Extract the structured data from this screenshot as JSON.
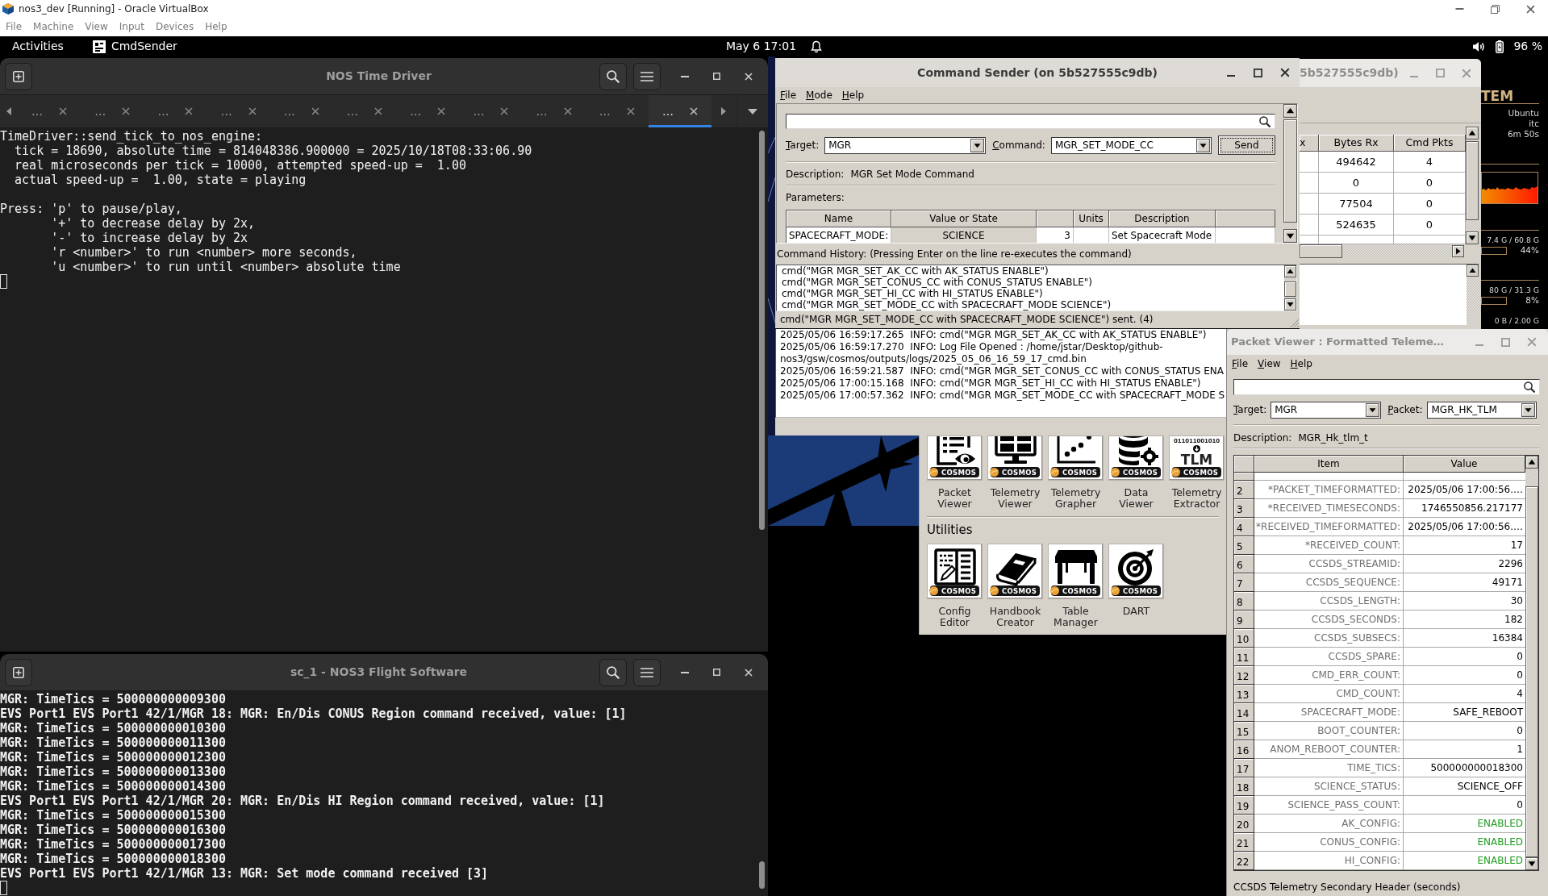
{
  "host_window": {
    "title": "nos3_dev [Running] - Oracle VirtualBox",
    "menu": [
      "File",
      "Machine",
      "View",
      "Input",
      "Devices",
      "Help"
    ]
  },
  "top_bar": {
    "activities": "Activities",
    "app": "CmdSender",
    "clock": "May 6 17:01",
    "battery": "96 %"
  },
  "time_driver_terminal": {
    "title": "NOS Time Driver",
    "tabs": [
      {
        "label": "…",
        "selected": false
      },
      {
        "label": "…",
        "selected": false
      },
      {
        "label": "…",
        "selected": false
      },
      {
        "label": "…",
        "selected": false
      },
      {
        "label": "…",
        "selected": false
      },
      {
        "label": "…",
        "selected": false
      },
      {
        "label": "…",
        "selected": false
      },
      {
        "label": "…",
        "selected": false
      },
      {
        "label": "…",
        "selected": false
      },
      {
        "label": "…",
        "selected": false
      },
      {
        "label": "…",
        "selected": true
      }
    ],
    "output": [
      {
        "kind": "section",
        "text": "TimeDriver::send_tick_to_nos_engine:",
        "children": [
          "tick = 18690, absolute time = 814048386.900000 = 2025/10/18T08:33:06.90",
          "real microseconds per tick = 10000, attempted speed-up =  1.00",
          "actual speed-up =  1.00, state = playing"
        ]
      },
      {
        "kind": "prompt",
        "label": "Press:",
        "options": [
          "'p' to pause/play,",
          "'+' to decrease delay by 2x,",
          "'-' to increase delay by 2x",
          "'r <number>' to run <number> more seconds,",
          "'u <number>' to run until <number> absolute time"
        ]
      }
    ]
  },
  "command_sender": {
    "title": "Command Sender (on 5b527555c9db)",
    "menu": [
      "File",
      "Mode",
      "Help"
    ],
    "target_label": "Target:",
    "target": "MGR",
    "command_label": "Command:",
    "command": "MGR_SET_MODE_CC",
    "send_button": "Send",
    "description_label": "Description:",
    "description": "MGR Set Mode Command",
    "parameters_label": "Parameters:",
    "parameters": {
      "columns": {
        "name": "Name",
        "value": "Value or State",
        "units": "Units",
        "description": "Description"
      },
      "rows": [
        {
          "name": "SPACECRAFT_MODE:",
          "value": "SCIENCE",
          "column_3": "3",
          "description": "Set Spacecraft Mode"
        }
      ]
    },
    "history_label": "Command History: (Pressing Enter on the line re-executes the command)",
    "history": [
      "cmd(\"MGR MGR_SET_AK_CC with AK_STATUS ENABLE\")",
      "cmd(\"MGR MGR_SET_CONUS_CC with CONUS_STATUS ENABLE\")",
      "cmd(\"MGR MGR_SET_HI_CC with HI_STATUS ENABLE\")",
      "cmd(\"MGR MGR_SET_MODE_CC with SPACECRAFT_MODE SCIENCE\")"
    ],
    "status": "cmd(\"MGR MGR_SET_MODE_CC with SPACECRAFT_MODE SCIENCE\") sent. (4)"
  },
  "cmd_tlm_server": {
    "title": "5b527555c9db)",
    "columns": [
      "x",
      "Bytes Rx",
      "Cmd Pkts"
    ],
    "rows": [
      {
        "bytes_rx": "494642",
        "cmd_pkts": "4"
      },
      {
        "bytes_rx": "0",
        "cmd_pkts": "0"
      },
      {
        "bytes_rx": "77504",
        "cmd_pkts": "0"
      },
      {
        "bytes_rx": "524635",
        "cmd_pkts": "0"
      }
    ],
    "log": [
      "2025/05/06 16:59:17.265  INFO: cmd(\"MGR MGR_SET_AK_CC with AK_STATUS ENABLE\")",
      "2025/05/06 16:59:17.270  INFO: Log File Opened : /home/jstar/Desktop/github-",
      "nos3/gsw/cosmos/outputs/logs/2025_05_06_16_59_17_cmd.bin",
      "2025/05/06 16:59:21.587  INFO: cmd(\"MGR MGR_SET_CONUS_CC with CONUS_STATUS ENA",
      "2025/05/06 17:00:15.168  INFO: cmd(\"MGR MGR_SET_HI_CC with HI_STATUS ENABLE\")",
      "2025/05/06 17:00:57.362  INFO: cmd(\"MGR MGR_SET_MODE_CC with SPACECRAFT_MODE S"
    ]
  },
  "system_monitor": {
    "heading": "TEM",
    "info": [
      "Ubuntu",
      "itc",
      "6m 50s"
    ],
    "groups": [
      [
        {
          "text": "7.4 G / 60.8 G",
          "percent": "44%"
        }
      ],
      [
        {
          "text": "80 G / 31.3 G",
          "percent": "8%"
        },
        {
          "text": "0 B / 2.00 G"
        }
      ]
    ]
  },
  "launcher": {
    "tools": [
      {
        "label": "Packet Viewer",
        "badge": "COSMOS"
      },
      {
        "label": "Telemetry Viewer",
        "badge": "COSMOS"
      },
      {
        "label": "Telemetry Grapher",
        "badge": "COSMOS"
      },
      {
        "label": "Data Viewer",
        "badge": "COSMOS"
      },
      {
        "label": "Telemetry Extractor",
        "badge": "COSMOS",
        "icon_text": [
          "011011001010",
          "TLM"
        ]
      }
    ],
    "utilities_label": "Utilities",
    "utilities": [
      {
        "label": "Config Editor",
        "badge": "COSMOS"
      },
      {
        "label": "Handbook Creator",
        "badge": "COSMOS"
      },
      {
        "label": "Table Manager",
        "badge": "COSMOS"
      },
      {
        "label": "DART",
        "badge": "COSMOS"
      }
    ]
  },
  "packet_viewer": {
    "title": "Packet Viewer : Formatted Teleme…",
    "menu": [
      "File",
      "View",
      "Help"
    ],
    "target_label": "Target:",
    "target": "MGR",
    "packet_label": "Packet:",
    "packet": "MGR_HK_TLM",
    "description_label": "Description:",
    "description": "MGR_Hk_tlm_t",
    "columns": [
      "Item",
      "Value"
    ],
    "rows": [
      {
        "index": "2",
        "item": "*PACKET_TIMEFORMATTED:",
        "value": "2025/05/06 17:00:56.…"
      },
      {
        "index": "3",
        "item": "*RECEIVED_TIMESECONDS:",
        "value": "1746550856.217177"
      },
      {
        "index": "4",
        "item": "*RECEIVED_TIMEFORMATTED:",
        "value": "2025/05/06 17:00:56.…"
      },
      {
        "index": "5",
        "item": "*RECEIVED_COUNT:",
        "value": "17"
      },
      {
        "index": "6",
        "item": "CCSDS_STREAMID:",
        "value": "2296"
      },
      {
        "index": "7",
        "item": "CCSDS_SEQUENCE:",
        "value": "49171"
      },
      {
        "index": "8",
        "item": "CCSDS_LENGTH:",
        "value": "30"
      },
      {
        "index": "9",
        "item": "CCSDS_SECONDS:",
        "value": "182"
      },
      {
        "index": "10",
        "item": "CCSDS_SUBSECS:",
        "value": "16384"
      },
      {
        "index": "11",
        "item": "CCSDS_SPARE:",
        "value": "0"
      },
      {
        "index": "12",
        "item": "CMD_ERR_COUNT:",
        "value": "0"
      },
      {
        "index": "13",
        "item": "CMD_COUNT:",
        "value": "4"
      },
      {
        "index": "14",
        "item": "SPACECRAFT_MODE:",
        "value": "SAFE_REBOOT"
      },
      {
        "index": "15",
        "item": "BOOT_COUNTER:",
        "value": "0"
      },
      {
        "index": "16",
        "item": "ANOM_REBOOT_COUNTER:",
        "value": "1"
      },
      {
        "index": "17",
        "item": "TIME_TICS:",
        "value": "500000000018300"
      },
      {
        "index": "18",
        "item": "SCIENCE_STATUS:",
        "value": "SCIENCE_OFF"
      },
      {
        "index": "19",
        "item": "SCIENCE_PASS_COUNT:",
        "value": "0"
      },
      {
        "index": "20",
        "item": "AK_CONFIG:",
        "value": "ENABLED",
        "color": "#1e9e1e"
      },
      {
        "index": "21",
        "item": "CONUS_CONFIG:",
        "value": "ENABLED",
        "color": "#1e9e1e"
      },
      {
        "index": "22",
        "item": "HI_CONFIG:",
        "value": "ENABLED",
        "color": "#1e9e1e"
      }
    ],
    "status": "CCSDS Telemetry Secondary Header (seconds)"
  },
  "flight_software_terminal": {
    "title": "sc_1 - NOS3 Flight Software",
    "lines": [
      "MGR: TimeTics = 500000000009300",
      "EVS Port1 EVS Port1 42/1/MGR 18: MGR: En/Dis CONUS Region command received, value: [1]",
      "MGR: TimeTics = 500000000010300",
      "MGR: TimeTics = 500000000011300",
      "MGR: TimeTics = 500000000012300",
      "MGR: TimeTics = 500000000013300",
      "MGR: TimeTics = 500000000014300",
      "EVS Port1 EVS Port1 42/1/MGR 20: MGR: En/Dis HI Region command received, value: [1]",
      "MGR: TimeTics = 500000000015300",
      "MGR: TimeTics = 500000000016300",
      "MGR: TimeTics = 500000000017300",
      "MGR: TimeTics = 500000000018300",
      "EVS Port1 EVS Port1 42/1/MGR 13: MGR: Set mode command received [3]"
    ]
  }
}
